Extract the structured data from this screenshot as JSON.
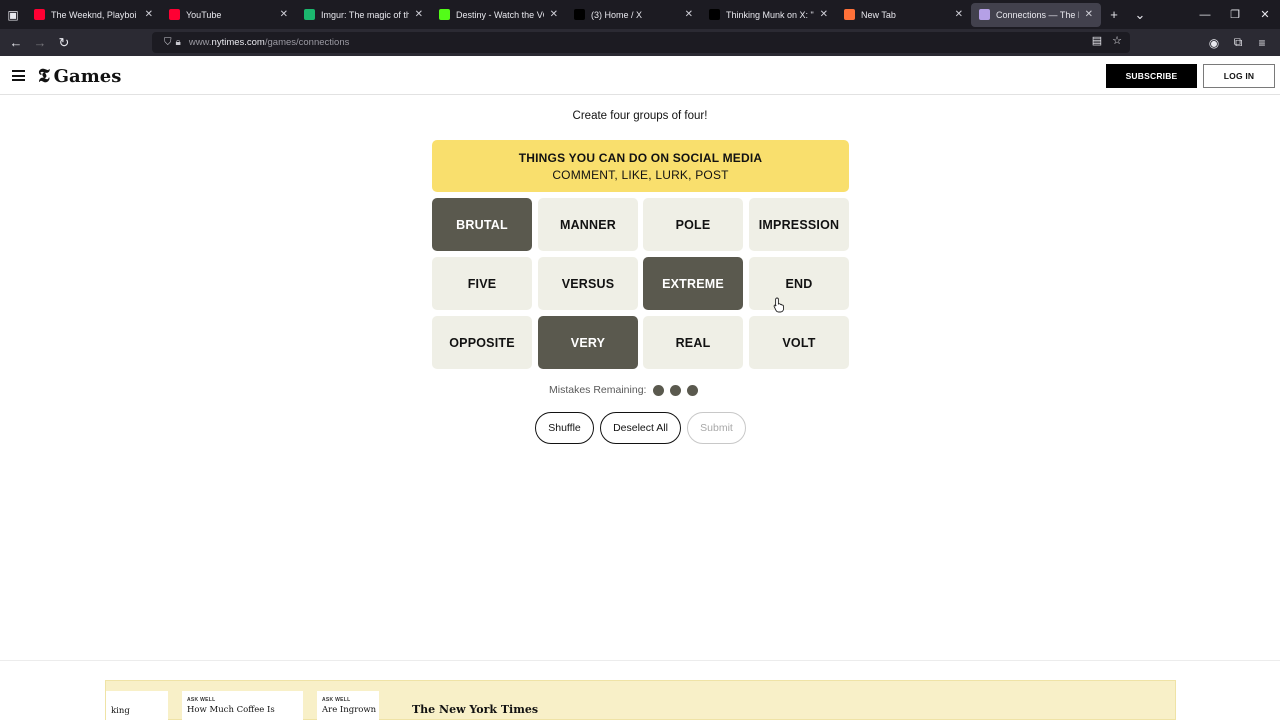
{
  "browser": {
    "tabs": [
      {
        "title": "The Weeknd, Playboi C",
        "favicon": "youtube-icon",
        "color": "#ff0033",
        "active": false
      },
      {
        "title": "YouTube",
        "favicon": "youtube-icon",
        "color": "#ff0033",
        "active": false
      },
      {
        "title": "Imgur: The magic of the Int",
        "favicon": "imgur-icon",
        "color": "#1bb76e",
        "active": false
      },
      {
        "title": "Destiny - Watch the VOD o",
        "favicon": "kick-icon",
        "color": "#53fc18",
        "active": false
      },
      {
        "title": "(3) Home / X",
        "favicon": "x-icon",
        "color": "#000000",
        "active": false
      },
      {
        "title": "Thinking Munk on X: \"I",
        "favicon": "x-icon",
        "color": "#000000",
        "active": false
      },
      {
        "title": "New Tab",
        "favicon": "firefox-icon",
        "color": "#ff7139",
        "active": false
      },
      {
        "title": "Connections — The New Y",
        "favicon": "connections-icon",
        "color": "#b5a0e6",
        "active": true
      }
    ],
    "url_prefix": "www.",
    "url_host": "nytimes.com",
    "url_path": "/games/connections"
  },
  "header": {
    "logo_t": "𝕿",
    "logo_text": "Games",
    "subscribe_label": "SUBSCRIBE",
    "login_label": "LOG IN"
  },
  "game": {
    "instruction": "Create four groups of four!",
    "solved": {
      "category": "THINGS YOU CAN DO ON SOCIAL MEDIA",
      "words": "COMMENT, LIKE, LURK, POST",
      "color": "#f9df6d"
    },
    "tiles": [
      {
        "word": "BRUTAL",
        "selected": true
      },
      {
        "word": "MANNER",
        "selected": false
      },
      {
        "word": "POLE",
        "selected": false
      },
      {
        "word": "IMPRESSION",
        "selected": false
      },
      {
        "word": "FIVE",
        "selected": false
      },
      {
        "word": "VERSUS",
        "selected": false
      },
      {
        "word": "EXTREME",
        "selected": true
      },
      {
        "word": "END",
        "selected": false
      },
      {
        "word": "OPPOSITE",
        "selected": false
      },
      {
        "word": "VERY",
        "selected": true
      },
      {
        "word": "REAL",
        "selected": false
      },
      {
        "word": "VOLT",
        "selected": false
      }
    ],
    "mistakes_label": "Mistakes Remaining:",
    "mistakes_remaining": 3,
    "buttons": {
      "shuffle": "Shuffle",
      "deselect": "Deselect All",
      "submit": "Submit"
    }
  },
  "footer": {
    "cards": [
      {
        "kicker": "",
        "headline": "king"
      },
      {
        "kicker": "ASK WELL",
        "headline": "How Much Coffee Is"
      },
      {
        "kicker": "ASK WELL",
        "headline": "Are Ingrown H"
      }
    ],
    "brand": "The New York Times"
  }
}
